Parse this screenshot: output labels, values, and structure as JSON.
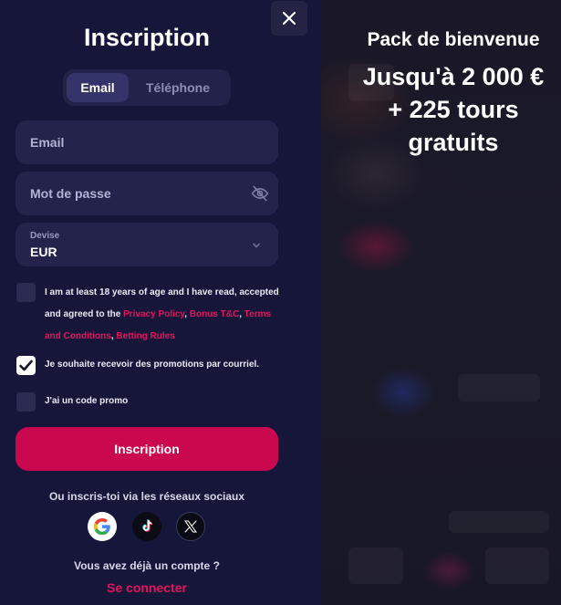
{
  "modal": {
    "title": "Inscription",
    "tabs": [
      {
        "label": "Email",
        "active": true
      },
      {
        "label": "Téléphone",
        "active": false
      }
    ],
    "email": {
      "placeholder": "Email"
    },
    "password": {
      "placeholder": "Mot de passe"
    },
    "currency": {
      "label": "Devise",
      "value": "EUR"
    },
    "terms": {
      "text_before": "I am at least 18 years of age and I have read, accepted and agreed to the ",
      "link_privacy": "Privacy Policy",
      "sep1": ", ",
      "link_bonus": "Bonus T&C",
      "sep2": ", ",
      "link_terms": "Terms and Conditions",
      "sep3": ", ",
      "link_betting": "Betting Rules",
      "checked": false
    },
    "promotions": {
      "label": "Je souhaite recevoir des promotions par courriel.",
      "checked": true
    },
    "promo_code": {
      "label": "J'ai un code promo",
      "checked": false
    },
    "submit_label": "Inscription",
    "social_label": "Ou inscris-toi via les réseaux sociaux",
    "social": [
      {
        "name": "google",
        "icon": "google-icon"
      },
      {
        "name": "tiktok",
        "icon": "tiktok-icon"
      },
      {
        "name": "x",
        "icon": "x-icon"
      }
    ],
    "have_account": "Vous avez déjà un compte ?",
    "login_link": "Se connecter"
  },
  "promo": {
    "title": "Pack de bienvenue",
    "line1": "Jusqu'à 2 000 €",
    "line2": "+ 225 tours",
    "line3": "gratuits"
  },
  "colors": {
    "panel_bg": "#16163a",
    "field_bg": "#23234c",
    "accent": "#c9084e",
    "link": "#e3135d"
  }
}
